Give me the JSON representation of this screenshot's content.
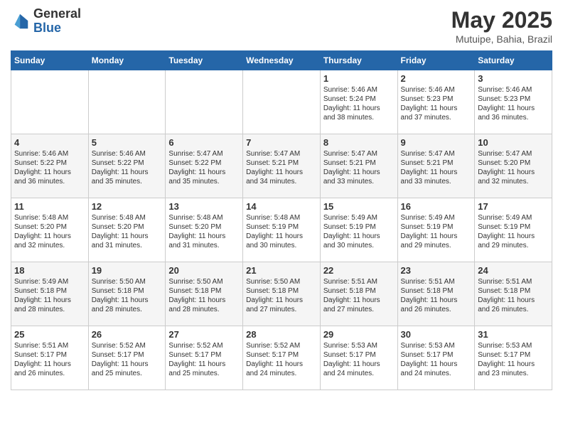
{
  "header": {
    "logo_general": "General",
    "logo_blue": "Blue",
    "title": "May 2025",
    "location": "Mutuipe, Bahia, Brazil"
  },
  "weekdays": [
    "Sunday",
    "Monday",
    "Tuesday",
    "Wednesday",
    "Thursday",
    "Friday",
    "Saturday"
  ],
  "weeks": [
    [
      {
        "day": "",
        "text": ""
      },
      {
        "day": "",
        "text": ""
      },
      {
        "day": "",
        "text": ""
      },
      {
        "day": "",
        "text": ""
      },
      {
        "day": "1",
        "text": "Sunrise: 5:46 AM\nSunset: 5:24 PM\nDaylight: 11 hours\nand 38 minutes."
      },
      {
        "day": "2",
        "text": "Sunrise: 5:46 AM\nSunset: 5:23 PM\nDaylight: 11 hours\nand 37 minutes."
      },
      {
        "day": "3",
        "text": "Sunrise: 5:46 AM\nSunset: 5:23 PM\nDaylight: 11 hours\nand 36 minutes."
      }
    ],
    [
      {
        "day": "4",
        "text": "Sunrise: 5:46 AM\nSunset: 5:22 PM\nDaylight: 11 hours\nand 36 minutes."
      },
      {
        "day": "5",
        "text": "Sunrise: 5:46 AM\nSunset: 5:22 PM\nDaylight: 11 hours\nand 35 minutes."
      },
      {
        "day": "6",
        "text": "Sunrise: 5:47 AM\nSunset: 5:22 PM\nDaylight: 11 hours\nand 35 minutes."
      },
      {
        "day": "7",
        "text": "Sunrise: 5:47 AM\nSunset: 5:21 PM\nDaylight: 11 hours\nand 34 minutes."
      },
      {
        "day": "8",
        "text": "Sunrise: 5:47 AM\nSunset: 5:21 PM\nDaylight: 11 hours\nand 33 minutes."
      },
      {
        "day": "9",
        "text": "Sunrise: 5:47 AM\nSunset: 5:21 PM\nDaylight: 11 hours\nand 33 minutes."
      },
      {
        "day": "10",
        "text": "Sunrise: 5:47 AM\nSunset: 5:20 PM\nDaylight: 11 hours\nand 32 minutes."
      }
    ],
    [
      {
        "day": "11",
        "text": "Sunrise: 5:48 AM\nSunset: 5:20 PM\nDaylight: 11 hours\nand 32 minutes."
      },
      {
        "day": "12",
        "text": "Sunrise: 5:48 AM\nSunset: 5:20 PM\nDaylight: 11 hours\nand 31 minutes."
      },
      {
        "day": "13",
        "text": "Sunrise: 5:48 AM\nSunset: 5:20 PM\nDaylight: 11 hours\nand 31 minutes."
      },
      {
        "day": "14",
        "text": "Sunrise: 5:48 AM\nSunset: 5:19 PM\nDaylight: 11 hours\nand 30 minutes."
      },
      {
        "day": "15",
        "text": "Sunrise: 5:49 AM\nSunset: 5:19 PM\nDaylight: 11 hours\nand 30 minutes."
      },
      {
        "day": "16",
        "text": "Sunrise: 5:49 AM\nSunset: 5:19 PM\nDaylight: 11 hours\nand 29 minutes."
      },
      {
        "day": "17",
        "text": "Sunrise: 5:49 AM\nSunset: 5:19 PM\nDaylight: 11 hours\nand 29 minutes."
      }
    ],
    [
      {
        "day": "18",
        "text": "Sunrise: 5:49 AM\nSunset: 5:18 PM\nDaylight: 11 hours\nand 28 minutes."
      },
      {
        "day": "19",
        "text": "Sunrise: 5:50 AM\nSunset: 5:18 PM\nDaylight: 11 hours\nand 28 minutes."
      },
      {
        "day": "20",
        "text": "Sunrise: 5:50 AM\nSunset: 5:18 PM\nDaylight: 11 hours\nand 28 minutes."
      },
      {
        "day": "21",
        "text": "Sunrise: 5:50 AM\nSunset: 5:18 PM\nDaylight: 11 hours\nand 27 minutes."
      },
      {
        "day": "22",
        "text": "Sunrise: 5:51 AM\nSunset: 5:18 PM\nDaylight: 11 hours\nand 27 minutes."
      },
      {
        "day": "23",
        "text": "Sunrise: 5:51 AM\nSunset: 5:18 PM\nDaylight: 11 hours\nand 26 minutes."
      },
      {
        "day": "24",
        "text": "Sunrise: 5:51 AM\nSunset: 5:18 PM\nDaylight: 11 hours\nand 26 minutes."
      }
    ],
    [
      {
        "day": "25",
        "text": "Sunrise: 5:51 AM\nSunset: 5:17 PM\nDaylight: 11 hours\nand 26 minutes."
      },
      {
        "day": "26",
        "text": "Sunrise: 5:52 AM\nSunset: 5:17 PM\nDaylight: 11 hours\nand 25 minutes."
      },
      {
        "day": "27",
        "text": "Sunrise: 5:52 AM\nSunset: 5:17 PM\nDaylight: 11 hours\nand 25 minutes."
      },
      {
        "day": "28",
        "text": "Sunrise: 5:52 AM\nSunset: 5:17 PM\nDaylight: 11 hours\nand 24 minutes."
      },
      {
        "day": "29",
        "text": "Sunrise: 5:53 AM\nSunset: 5:17 PM\nDaylight: 11 hours\nand 24 minutes."
      },
      {
        "day": "30",
        "text": "Sunrise: 5:53 AM\nSunset: 5:17 PM\nDaylight: 11 hours\nand 24 minutes."
      },
      {
        "day": "31",
        "text": "Sunrise: 5:53 AM\nSunset: 5:17 PM\nDaylight: 11 hours\nand 23 minutes."
      }
    ]
  ]
}
